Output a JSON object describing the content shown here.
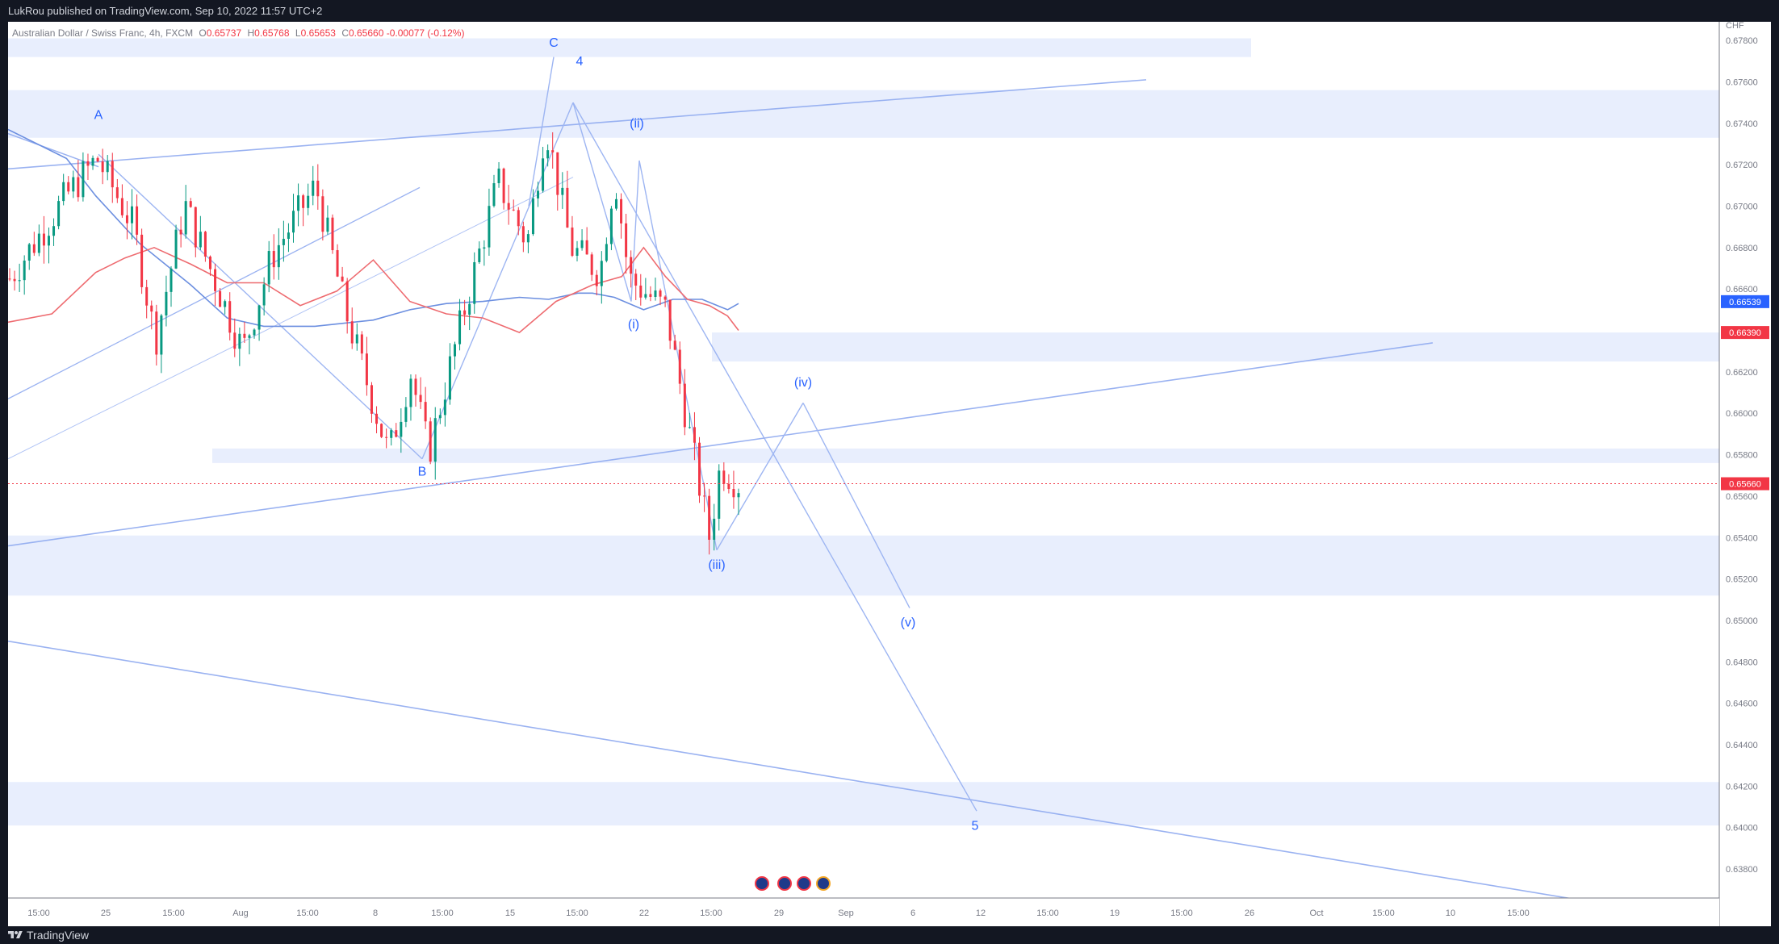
{
  "header": {
    "published": "LukRou published on TradingView.com, Sep 10, 2022 11:57 UTC+2"
  },
  "footer": {
    "brand": "TradingView",
    "logo": "tradingview-logo"
  },
  "legend": {
    "symbol": "Australian Dollar / Swiss Franc, 4h, FXCM",
    "o_label": "O",
    "o": "0.65737",
    "h_label": "H",
    "h": "0.65768",
    "l_label": "L",
    "l": "0.65653",
    "c_label": "C",
    "c": "0.65660",
    "change": "-0.00077 (-0.12%)"
  },
  "colors": {
    "up": "#089981",
    "down": "#f23645",
    "wave": "#2962ff",
    "zone": "#e8eefd",
    "ma_red": "#ee6b70",
    "ma_blue": "#6c8fe0"
  },
  "chart_data": {
    "type": "candlestick",
    "currency": "CHF",
    "ylim": [
      0.6366,
      0.6789
    ],
    "y_ticks": [
      "0.67800",
      "0.67600",
      "0.67400",
      "0.67200",
      "0.67000",
      "0.66800",
      "0.66600",
      "0.66400",
      "0.66200",
      "0.66000",
      "0.65800",
      "0.65600",
      "0.65400",
      "0.65200",
      "0.65000",
      "0.64800",
      "0.64600",
      "0.64400",
      "0.64200",
      "0.64000",
      "0.63800"
    ],
    "x_ticks": [
      "15:00",
      "25",
      "15:00",
      "Aug",
      "15:00",
      "8",
      "15:00",
      "15",
      "15:00",
      "22",
      "15:00",
      "29",
      "Sep",
      "6",
      "12",
      "15:00",
      "19",
      "15:00",
      "26",
      "Oct",
      "15:00",
      "10",
      "15:00"
    ],
    "price_labels": [
      {
        "value": 0.66539,
        "text": "0.66539",
        "color": "#2962ff"
      },
      {
        "value": 0.6639,
        "text": "0.66390",
        "color": "#f23645"
      },
      {
        "value": 0.6566,
        "text": "0.65660",
        "color": "#f23645"
      }
    ],
    "wave_labels": [
      "A",
      "B",
      "C",
      "4",
      "(i)",
      "(ii)",
      "(iii)",
      "(iv)",
      "(v)",
      "5"
    ],
    "zones": [
      [
        0.6772,
        0.6781
      ],
      [
        0.6733,
        0.6756
      ],
      [
        0.6625,
        0.6639
      ],
      [
        0.6576,
        0.6583
      ],
      [
        0.6512,
        0.6541
      ],
      [
        0.6401,
        0.6422
      ]
    ],
    "ma_blue": [
      [
        0,
        0.6737
      ],
      [
        0.08,
        0.6723
      ],
      [
        0.12,
        0.6705
      ],
      [
        0.18,
        0.6682
      ],
      [
        0.25,
        0.6662
      ],
      [
        0.3,
        0.6646
      ],
      [
        0.35,
        0.6642
      ],
      [
        0.42,
        0.6642
      ],
      [
        0.5,
        0.6645
      ],
      [
        0.55,
        0.665
      ],
      [
        0.6,
        0.6653
      ],
      [
        0.65,
        0.6654
      ],
      [
        0.7,
        0.6656
      ],
      [
        0.74,
        0.6655
      ],
      [
        0.78,
        0.6658
      ],
      [
        0.8,
        0.6658
      ],
      [
        0.83,
        0.6656
      ],
      [
        0.87,
        0.665
      ],
      [
        0.91,
        0.6655
      ],
      [
        0.95,
        0.6655
      ],
      [
        0.985,
        0.665
      ],
      [
        1,
        0.6653
      ]
    ],
    "ma_red": [
      [
        0,
        0.6644
      ],
      [
        0.06,
        0.6648
      ],
      [
        0.12,
        0.6668
      ],
      [
        0.16,
        0.6675
      ],
      [
        0.2,
        0.668
      ],
      [
        0.25,
        0.6672
      ],
      [
        0.3,
        0.6663
      ],
      [
        0.35,
        0.6663
      ],
      [
        0.4,
        0.6652
      ],
      [
        0.45,
        0.6659
      ],
      [
        0.5,
        0.6674
      ],
      [
        0.55,
        0.6654
      ],
      [
        0.6,
        0.6648
      ],
      [
        0.65,
        0.6646
      ],
      [
        0.7,
        0.6639
      ],
      [
        0.75,
        0.6654
      ],
      [
        0.8,
        0.6662
      ],
      [
        0.84,
        0.6666
      ],
      [
        0.87,
        0.668
      ],
      [
        0.9,
        0.6666
      ],
      [
        0.93,
        0.6655
      ],
      [
        0.96,
        0.6652
      ],
      [
        0.985,
        0.6647
      ],
      [
        1,
        0.664
      ]
    ],
    "price_path": [
      [
        0,
        0.6665
      ],
      [
        0.08,
        0.6706
      ],
      [
        0.12,
        0.6723
      ],
      [
        0.17,
        0.669
      ],
      [
        0.2,
        0.6635
      ],
      [
        0.24,
        0.6701
      ],
      [
        0.32,
        0.663
      ],
      [
        0.36,
        0.6676
      ],
      [
        0.42,
        0.671
      ],
      [
        0.46,
        0.665
      ],
      [
        0.52,
        0.658
      ],
      [
        0.55,
        0.662
      ],
      [
        0.575,
        0.6581
      ],
      [
        0.62,
        0.6645
      ],
      [
        0.67,
        0.6712
      ],
      [
        0.71,
        0.6682
      ],
      [
        0.735,
        0.674
      ],
      [
        0.77,
        0.668
      ],
      [
        0.81,
        0.6668
      ],
      [
        0.83,
        0.6716
      ],
      [
        0.85,
        0.6665
      ],
      [
        0.9,
        0.665
      ],
      [
        0.93,
        0.6595
      ],
      [
        0.96,
        0.654
      ],
      [
        0.975,
        0.6575
      ],
      [
        1,
        0.6566
      ]
    ],
    "line": {
      "points": []
    }
  }
}
